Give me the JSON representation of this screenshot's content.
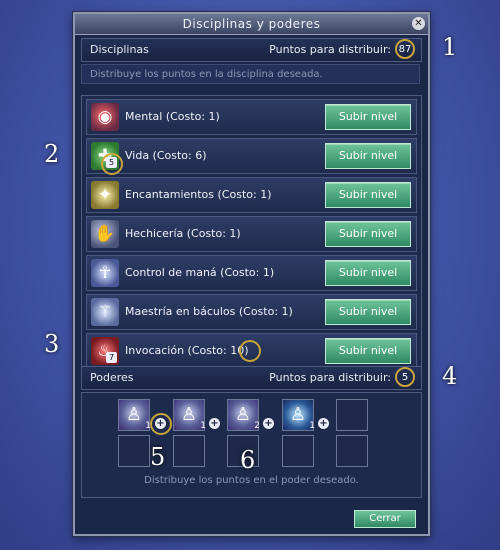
{
  "window": {
    "title": "Disciplinas y poderes",
    "close_glyph": "✕"
  },
  "disciplines": {
    "header_label": "Disciplinas",
    "points_label": "Puntos para distribuir:",
    "points_value": "87",
    "hint": "Distribuye los puntos en la disciplina deseada.",
    "items": [
      {
        "label": "Mental (Costo: 1)",
        "icon": "brain-eye-icon",
        "glyph": "◉",
        "badge": "",
        "button": "Subir nivel"
      },
      {
        "label": "Vida (Costo: 6)",
        "icon": "green-cross-icon",
        "glyph": "✚",
        "badge": "5",
        "button": "Subir nivel"
      },
      {
        "label": "Encantamientos (Costo: 1)",
        "icon": "sparkle-orb-icon",
        "glyph": "✦",
        "badge": "",
        "button": "Subir nivel"
      },
      {
        "label": "Hechicería (Costo: 1)",
        "icon": "raised-hand-icon",
        "glyph": "✋",
        "badge": "",
        "button": "Subir nivel"
      },
      {
        "label": "Control de maná (Costo: 1)",
        "icon": "mage-figure-icon",
        "glyph": "☥",
        "badge": "",
        "button": "Subir nivel"
      },
      {
        "label": "Maestría en báculos (Costo: 1)",
        "icon": "staff-icon",
        "glyph": "⚚",
        "badge": "",
        "button": "Subir nivel"
      },
      {
        "label": "Invocación (Costo: 10)",
        "icon": "red-summon-icon",
        "glyph": "♨",
        "badge": "7",
        "button": "Subir nivel"
      }
    ]
  },
  "powers": {
    "header_label": "Poderes",
    "points_label": "Puntos para distribuir:",
    "points_value": "5",
    "slots_row1": [
      {
        "icon": "power-figure-icon",
        "glyph": "♙",
        "level": "1"
      },
      {
        "icon": "power-figure-icon",
        "glyph": "♙",
        "level": "1"
      },
      {
        "icon": "power-figure-icon",
        "glyph": "♙",
        "level": "2"
      },
      {
        "icon": "power-aura-icon",
        "glyph": "♙",
        "level": "1"
      },
      {
        "icon": "",
        "glyph": "",
        "level": ""
      }
    ],
    "hint": "Distribuye los puntos en el poder deseado."
  },
  "footer": {
    "close_button": "Cerrar"
  },
  "callouts": [
    "1",
    "2",
    "3",
    "4",
    "5",
    "6"
  ],
  "colors": {
    "accent_ring": "#c8a43a",
    "button_green": "#2f8a64",
    "panel": "#1b2746"
  }
}
